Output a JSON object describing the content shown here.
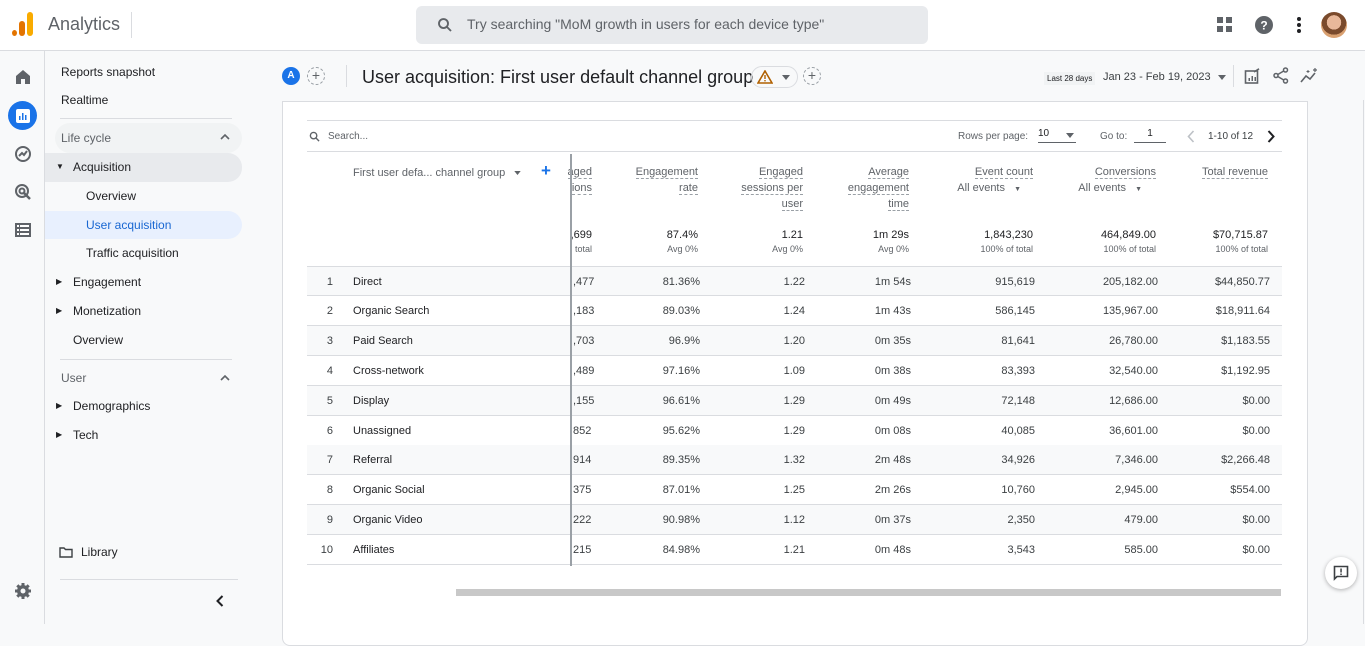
{
  "topbar": {
    "app_name": "Analytics",
    "search_placeholder": "Try searching \"MoM growth in users for each device type\"",
    "icons": [
      "apps-grid-icon",
      "help-icon",
      "more-vert-icon",
      "avatar"
    ]
  },
  "rail": {
    "items": [
      "home-icon",
      "reports-icon",
      "explore-icon",
      "advertising-icon",
      "configure-icon"
    ],
    "settings": "settings-gear-icon"
  },
  "sidebar": {
    "reports_snapshot": "Reports snapshot",
    "realtime": "Realtime",
    "lifecycle_label": "Life cycle",
    "acquisition": "Acquisition",
    "acq_overview": "Overview",
    "user_acquisition": "User acquisition",
    "traffic_acquisition": "Traffic acquisition",
    "engagement": "Engagement",
    "monetization": "Monetization",
    "lifecycle_overview": "Overview",
    "user_label": "User",
    "demographics": "Demographics",
    "tech": "Tech",
    "library": "Library"
  },
  "header": {
    "segment_badge": "A",
    "title": "User acquisition: First user default channel group",
    "date_chip": "Last 28 days",
    "date_range": "Jan 23 - Feb 19, 2023"
  },
  "table_controls": {
    "search_placeholder": "Search...",
    "rows_per_page_label": "Rows per page:",
    "rows_per_page_value": "10",
    "goto_label": "Go to:",
    "goto_value": "1",
    "range": "1-10 of 12"
  },
  "table": {
    "dimension_header": "First user defa... channel group",
    "columns": [
      {
        "line1": "aged",
        "line2": "ions",
        "line3": "",
        "sub": ""
      },
      {
        "line1": "Engagement",
        "line2": "rate",
        "line3": "",
        "sub": ""
      },
      {
        "line1": "Engaged",
        "line2": "sessions per",
        "line3": "user",
        "sub": ""
      },
      {
        "line1": "Average",
        "line2": "engagement",
        "line3": "time",
        "sub": ""
      },
      {
        "line1": "Event count",
        "line2": "",
        "line3": "",
        "sub": "All events"
      },
      {
        "line1": "Conversions",
        "line2": "",
        "line3": "",
        "sub": "All events"
      },
      {
        "line1": "Total revenue",
        "line2": "",
        "line3": "",
        "sub": ""
      }
    ],
    "totals": [
      {
        "value": ",699",
        "note": "total"
      },
      {
        "value": "87.4%",
        "note": "Avg 0%"
      },
      {
        "value": "1.21",
        "note": "Avg 0%"
      },
      {
        "value": "1m 29s",
        "note": "Avg 0%"
      },
      {
        "value": "1,843,230",
        "note": "100% of total"
      },
      {
        "value": "464,849.00",
        "note": "100% of total"
      },
      {
        "value": "$70,715.87",
        "note": "100% of total"
      }
    ],
    "rows": [
      {
        "n": "1",
        "name": "Direct",
        "c": [
          ",477",
          "81.36%",
          "1.22",
          "1m 54s",
          "915,619",
          "205,182.00",
          "$44,850.77"
        ]
      },
      {
        "n": "2",
        "name": "Organic Search",
        "c": [
          ",183",
          "89.03%",
          "1.24",
          "1m 43s",
          "586,145",
          "135,967.00",
          "$18,911.64"
        ]
      },
      {
        "n": "3",
        "name": "Paid Search",
        "c": [
          ",703",
          "96.9%",
          "1.20",
          "0m 35s",
          "81,641",
          "26,780.00",
          "$1,183.55"
        ]
      },
      {
        "n": "4",
        "name": "Cross-network",
        "c": [
          ",489",
          "97.16%",
          "1.09",
          "0m 38s",
          "83,393",
          "32,540.00",
          "$1,192.95"
        ]
      },
      {
        "n": "5",
        "name": "Display",
        "c": [
          ",155",
          "96.61%",
          "1.29",
          "0m 49s",
          "72,148",
          "12,686.00",
          "$0.00"
        ]
      },
      {
        "n": "6",
        "name": "Unassigned",
        "c": [
          "852",
          "95.62%",
          "1.29",
          "0m 08s",
          "40,085",
          "36,601.00",
          "$0.00"
        ]
      },
      {
        "n": "7",
        "name": "Referral",
        "c": [
          "914",
          "89.35%",
          "1.32",
          "2m 48s",
          "34,926",
          "7,346.00",
          "$2,266.48"
        ]
      },
      {
        "n": "8",
        "name": "Organic Social",
        "c": [
          "375",
          "87.01%",
          "1.25",
          "2m 26s",
          "10,760",
          "2,945.00",
          "$554.00"
        ]
      },
      {
        "n": "9",
        "name": "Organic Video",
        "c": [
          "222",
          "90.98%",
          "1.12",
          "0m 37s",
          "2,350",
          "479.00",
          "$0.00"
        ]
      },
      {
        "n": "10",
        "name": "Affiliates",
        "c": [
          "215",
          "84.98%",
          "1.21",
          "0m 48s",
          "3,543",
          "585.00",
          "$0.00"
        ]
      }
    ]
  },
  "colors": {
    "accent": "#1a73e8",
    "logo_orange": "#e37400",
    "logo_yellow": "#f9ab00",
    "warning": "#b06000"
  }
}
